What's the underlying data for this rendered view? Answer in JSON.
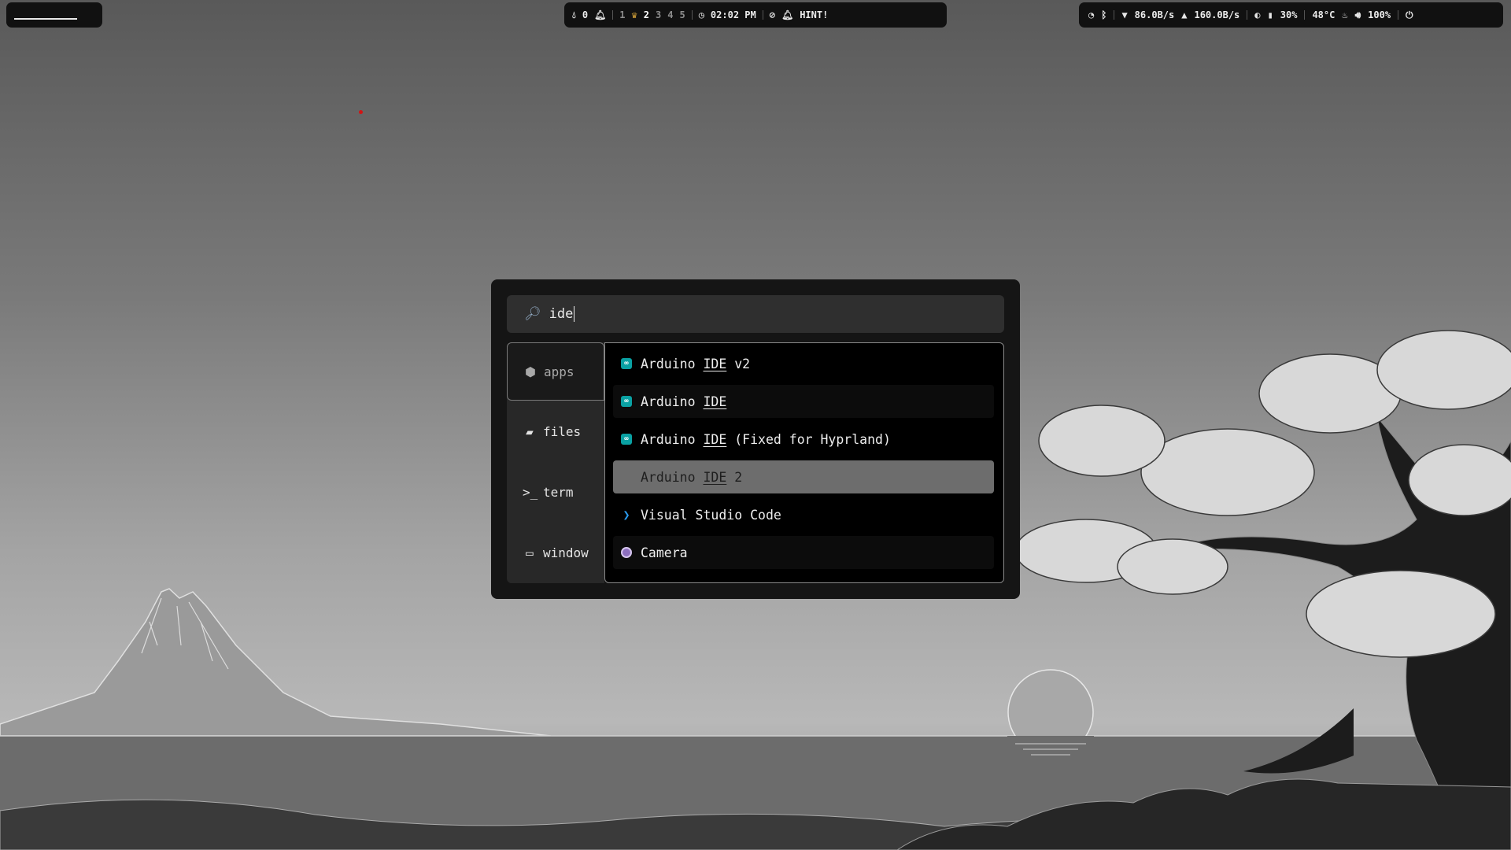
{
  "colors": {
    "bar_bg": "#111111",
    "launcher_bg": "#151515",
    "search_bg": "#2f2f2f",
    "selected_row": "#6d6d6d",
    "arduino_teal": "#0aa1a3",
    "vscode_blue": "#2a9bf0",
    "cursor_red": "#d21414"
  },
  "topbar": {
    "left": {
      "label": "________"
    },
    "center": {
      "drop_icon": "water-drop-icon",
      "notif_count": "0",
      "bell_icon": "bell-icon",
      "workspaces": [
        "1",
        "2",
        "3",
        "4",
        "5"
      ],
      "active_workspace": "2",
      "crown_icon": "crown-icon",
      "clock_icon": "clock-icon",
      "time": "02:02 PM",
      "eye_icon": "eye-off-icon",
      "hint_icon": "bell-ring-icon",
      "hint": "HINT!"
    },
    "right": {
      "wifi_icon": "wifi-icon",
      "bluetooth_icon": "bluetooth-icon",
      "down_speed": "86.0B/s",
      "up_speed": "160.0B/s",
      "brightness_icon": "brightness-icon",
      "battery": "30%",
      "temp": "48°C",
      "volume": "100%",
      "power_icon": "power-icon"
    }
  },
  "launcher": {
    "search": {
      "value": "ide",
      "icon": "magnifier-icon"
    },
    "modes": [
      {
        "label": "apps",
        "icon": "package-icon"
      },
      {
        "label": "files",
        "icon": "folder-icon"
      },
      {
        "label": "term",
        "icon": "terminal-icon"
      },
      {
        "label": "window",
        "icon": "window-icon"
      }
    ],
    "active_mode": "apps",
    "results": [
      {
        "pre": "Arduino ",
        "match": "IDE",
        "post": " v2",
        "icon": "arduino-icon"
      },
      {
        "pre": "Arduino ",
        "match": "IDE",
        "post": "",
        "icon": "arduino-icon"
      },
      {
        "pre": "Arduino ",
        "match": "IDE",
        "post": " (Fixed for Hyprland)",
        "icon": "arduino-icon"
      },
      {
        "pre": "Arduino ",
        "match": "IDE",
        "post": " 2",
        "icon": "none"
      },
      {
        "pre": "Visual Studio Code",
        "match": "",
        "post": "",
        "icon": "vscode-icon"
      },
      {
        "pre": "Camera",
        "match": "",
        "post": "",
        "icon": "camera-icon"
      }
    ],
    "selected_index": 3
  }
}
